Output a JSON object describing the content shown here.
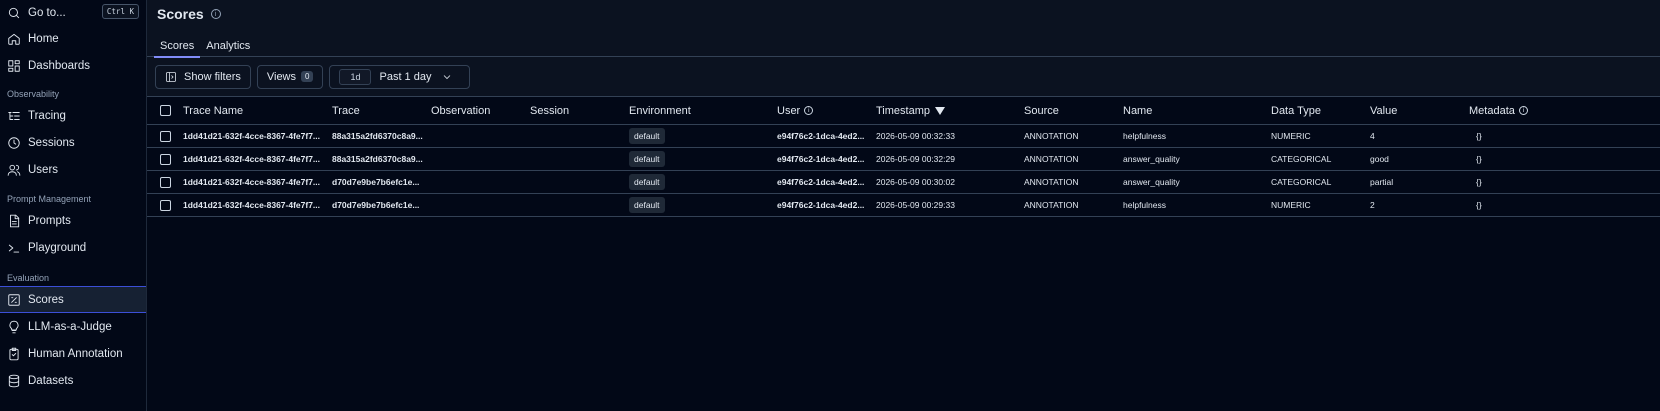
{
  "sidebar": {
    "goto": {
      "label": "Go to...",
      "shortcut": "Ctrl K",
      "icon": "search-icon"
    },
    "top_items": [
      {
        "label": "Home",
        "icon": "home-icon"
      },
      {
        "label": "Dashboards",
        "icon": "dashboard-icon"
      }
    ],
    "sections": [
      {
        "title": "Observability",
        "items": [
          {
            "label": "Tracing",
            "icon": "list-tree-icon"
          },
          {
            "label": "Sessions",
            "icon": "clock-icon"
          },
          {
            "label": "Users",
            "icon": "users-icon"
          }
        ]
      },
      {
        "title": "Prompt Management",
        "items": [
          {
            "label": "Prompts",
            "icon": "file-text-icon"
          },
          {
            "label": "Playground",
            "icon": "terminal-icon"
          }
        ]
      },
      {
        "title": "Evaluation",
        "items": [
          {
            "label": "Scores",
            "icon": "scores-icon",
            "active": true
          },
          {
            "label": "LLM-as-a-Judge",
            "icon": "lightbulb-icon"
          },
          {
            "label": "Human Annotation",
            "icon": "clipboard-icon"
          },
          {
            "label": "Datasets",
            "icon": "database-icon"
          }
        ]
      }
    ]
  },
  "header": {
    "title": "Scores",
    "tabs": [
      {
        "label": "Scores",
        "active": true
      },
      {
        "label": "Analytics",
        "active": false
      }
    ]
  },
  "toolbar": {
    "show_filters": "Show filters",
    "views": "Views",
    "views_count": "0",
    "date_chip": "1d",
    "date_range": "Past 1 day"
  },
  "table": {
    "columns": [
      "Trace Name",
      "Trace",
      "Observation",
      "Session",
      "Environment",
      "User",
      "Timestamp",
      "Source",
      "Name",
      "Data Type",
      "Value",
      "Metadata"
    ],
    "rows": [
      {
        "trace_name": "1dd41d21-632f-4cce-8367-4fe7f7...",
        "trace": "88a315a2fd6370c8a9...",
        "observation": "",
        "session": "",
        "environment": "default",
        "user": "e94f76c2-1dca-4ed2...",
        "timestamp": "2026-05-09 00:32:33",
        "source": "ANNOTATION",
        "name": "helpfulness",
        "data_type": "NUMERIC",
        "value": "4",
        "metadata": "{}"
      },
      {
        "trace_name": "1dd41d21-632f-4cce-8367-4fe7f7...",
        "trace": "88a315a2fd6370c8a9...",
        "observation": "",
        "session": "",
        "environment": "default",
        "user": "e94f76c2-1dca-4ed2...",
        "timestamp": "2026-05-09 00:32:29",
        "source": "ANNOTATION",
        "name": "answer_quality",
        "data_type": "CATEGORICAL",
        "value": "good",
        "metadata": "{}"
      },
      {
        "trace_name": "1dd41d21-632f-4cce-8367-4fe7f7...",
        "trace": "d70d7e9be7b6efc1e...",
        "observation": "",
        "session": "",
        "environment": "default",
        "user": "e94f76c2-1dca-4ed2...",
        "timestamp": "2026-05-09 00:30:02",
        "source": "ANNOTATION",
        "name": "answer_quality",
        "data_type": "CATEGORICAL",
        "value": "partial",
        "metadata": "{}"
      },
      {
        "trace_name": "1dd41d21-632f-4cce-8367-4fe7f7...",
        "trace": "d70d7e9be7b6efc1e...",
        "observation": "",
        "session": "",
        "environment": "default",
        "user": "e94f76c2-1dca-4ed2...",
        "timestamp": "2026-05-09 00:29:33",
        "source": "ANNOTATION",
        "name": "helpfulness",
        "data_type": "NUMERIC",
        "value": "2",
        "metadata": "{}"
      }
    ]
  }
}
